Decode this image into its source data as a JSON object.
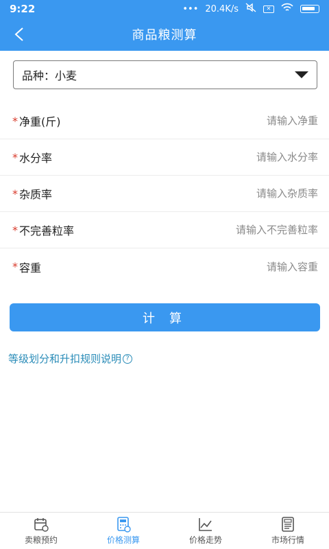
{
  "status_bar": {
    "time": "9:22",
    "network_speed": "20.4K/s",
    "sim_icon": "sim-x-icon",
    "wifi_icon": "wifi-icon",
    "battery_icon": "battery-charging-icon"
  },
  "app_bar": {
    "title": "商品粮测算",
    "back_icon": "back-arrow-icon"
  },
  "variety_select": {
    "label": "品种：小麦",
    "icon": "dropdown-caret-icon"
  },
  "form": {
    "fields": [
      {
        "label": "净重(斤)",
        "placeholder": "请输入净重",
        "required": true
      },
      {
        "label": "水分率",
        "placeholder": "请输入水分率",
        "required": true
      },
      {
        "label": "杂质率",
        "placeholder": "请输入杂质率",
        "required": true
      },
      {
        "label": "不完善粒率",
        "placeholder": "请输入不完善粒率",
        "required": true
      },
      {
        "label": "容重",
        "placeholder": "请输入容重",
        "required": true
      }
    ],
    "required_mark": "*"
  },
  "calculate_button": {
    "label": "计 算"
  },
  "rules_link": {
    "label": "等级划分和升扣规则说明",
    "icon": "help-circle-icon",
    "icon_glyph": "?"
  },
  "tab_bar": {
    "tabs": [
      {
        "label": "卖粮预约",
        "icon": "calendar-icon",
        "active": false
      },
      {
        "label": "价格测算",
        "icon": "calculator-icon",
        "active": true
      },
      {
        "label": "价格走势",
        "icon": "trend-chart-icon",
        "active": false
      },
      {
        "label": "市场行情",
        "icon": "newspaper-icon",
        "active": false
      }
    ]
  },
  "colors": {
    "primary": "#3a98f0",
    "required": "#d93b2c",
    "link": "#2a8cb8"
  }
}
